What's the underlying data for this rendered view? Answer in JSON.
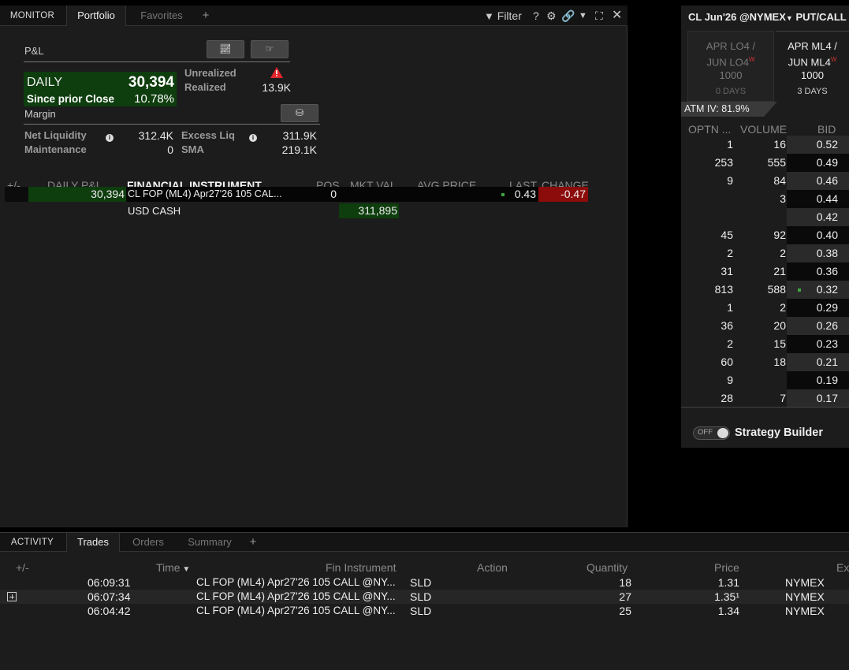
{
  "monitor": {
    "tabs": [
      {
        "label": "MONITOR"
      },
      {
        "label": "Portfolio"
      },
      {
        "label": "Favorites"
      },
      {
        "label": "+"
      }
    ],
    "filter_label": "Filter",
    "help_label": "?"
  },
  "pnl": {
    "title": "P&L",
    "daily_label": "DAILY",
    "daily_value": "30,394",
    "since_label": "Since prior Close",
    "since_value": "10.78%",
    "unrealized_label": "Unrealized",
    "realized_label": "Realized",
    "realized_value": "13.9K"
  },
  "margin": {
    "title": "Margin",
    "net_liq_label": "Net Liquidity",
    "net_liq_value": "312.4K",
    "excess_liq_label": "Excess Liq",
    "excess_liq_value": "311.9K",
    "maintenance_label": "Maintenance",
    "maintenance_value": "0",
    "sma_label": "SMA",
    "sma_value": "219.1K"
  },
  "portfolio_table": {
    "headers": {
      "plus_minus": "+/-",
      "daily_pl": "DAILY P&L",
      "instrument": "FINANCIAL INSTRUMENT",
      "pos": "POS",
      "mkt_val": "MKT VAL",
      "avg_price": "AVG PRICE",
      "last": "LAST",
      "change": "CHANGE"
    },
    "rows": [
      {
        "daily_pl": "30,394",
        "instrument": "CL FOP (ML4) Apr27'26 105 CAL...",
        "pos": "0",
        "mkt_val": "",
        "last": "0.43",
        "change": "-0.47"
      },
      {
        "daily_pl": "",
        "instrument": "USD CASH",
        "pos": "",
        "mkt_val": "311,895",
        "last": "",
        "change": ""
      }
    ]
  },
  "chain": {
    "title": "CL Jun'26 @NYMEX",
    "title_right": "PUT/CALL",
    "expiries": [
      {
        "line1": "APR LO4 /",
        "line2": "JUN LO4",
        "mult": "1000",
        "days": "0 DAYS",
        "badge": "W"
      },
      {
        "line1": "APR ML4 /",
        "line2": "JUN ML4",
        "mult": "1000",
        "days": "3 DAYS",
        "badge": "W"
      }
    ],
    "atm_iv": "ATM IV: 81.9%",
    "headers": {
      "optn": "OPTN ...",
      "volume": "VOLUME",
      "bid": "BID"
    },
    "rows": [
      {
        "optn": "1",
        "volume": "16",
        "bid": "0.52"
      },
      {
        "optn": "253",
        "volume": "555",
        "bid": "0.49"
      },
      {
        "optn": "9",
        "volume": "84",
        "bid": "0.46"
      },
      {
        "optn": "",
        "volume": "3",
        "bid": "0.44"
      },
      {
        "optn": "",
        "volume": "",
        "bid": "0.42"
      },
      {
        "optn": "45",
        "volume": "92",
        "bid": "0.40"
      },
      {
        "optn": "2",
        "volume": "2",
        "bid": "0.38"
      },
      {
        "optn": "31",
        "volume": "21",
        "bid": "0.36"
      },
      {
        "optn": "813",
        "volume": "588",
        "bid": "0.32"
      },
      {
        "optn": "1",
        "volume": "2",
        "bid": "0.29"
      },
      {
        "optn": "36",
        "volume": "20",
        "bid": "0.26"
      },
      {
        "optn": "2",
        "volume": "15",
        "bid": "0.23"
      },
      {
        "optn": "60",
        "volume": "18",
        "bid": "0.21"
      },
      {
        "optn": "9",
        "volume": "",
        "bid": "0.19"
      },
      {
        "optn": "28",
        "volume": "7",
        "bid": "0.17"
      }
    ],
    "strategy_toggle": "OFF",
    "strategy_label": "Strategy Builder"
  },
  "activity": {
    "tabs": [
      {
        "label": "ACTIVITY"
      },
      {
        "label": "Trades"
      },
      {
        "label": "Orders"
      },
      {
        "label": "Summary"
      },
      {
        "label": "+"
      }
    ],
    "headers": {
      "plus_minus": "+/-",
      "time": "Time",
      "instrument": "Fin Instrument",
      "action": "Action",
      "quantity": "Quantity",
      "price": "Price",
      "exchange": "Ex"
    },
    "trades": [
      {
        "time": "06:09:31",
        "instrument": "CL FOP (ML4) Apr27'26 105 CALL @NY...",
        "action": "SLD",
        "quantity": "18",
        "price": "1.31",
        "exchange": "NYMEX"
      },
      {
        "time": "06:07:34",
        "instrument": "CL FOP (ML4) Apr27'26 105 CALL @NY...",
        "action": "SLD",
        "quantity": "27",
        "price": "1.35¹",
        "exchange": "NYMEX"
      },
      {
        "time": "06:04:42",
        "instrument": "CL FOP (ML4) Apr27'26 105 CALL @NY...",
        "action": "SLD",
        "quantity": "25",
        "price": "1.34",
        "exchange": "NYMEX"
      }
    ]
  },
  "colors": {
    "pnl_green": "#0e3d0e",
    "loss_red": "#8c0b0b",
    "background": "#1c1c1c"
  }
}
